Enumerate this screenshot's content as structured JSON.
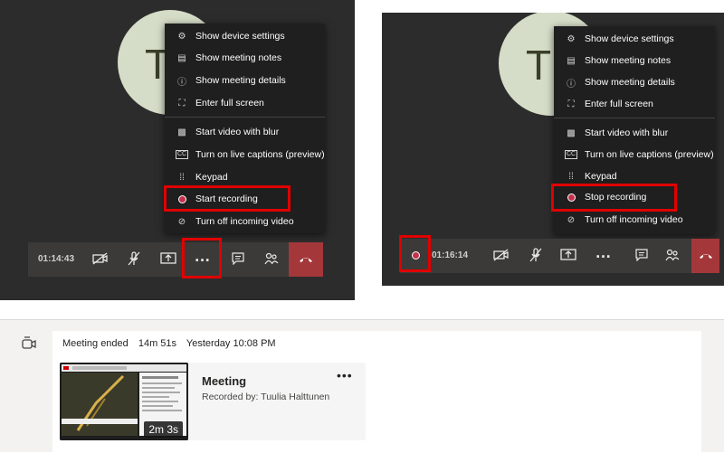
{
  "left_panel": {
    "avatar_letter": "T",
    "menu_items": [
      {
        "label": "Show device settings",
        "icon": "gear-icon"
      },
      {
        "label": "Show meeting notes",
        "icon": "notes-icon"
      },
      {
        "label": "Show meeting details",
        "icon": "info-icon"
      },
      {
        "label": "Enter full screen",
        "icon": "fullscreen-icon"
      },
      {
        "label": "Start video with blur",
        "icon": "blur-icon"
      },
      {
        "label": "Turn on live captions (preview)",
        "icon": "captions-icon"
      },
      {
        "label": "Keypad",
        "icon": "keypad-icon"
      },
      {
        "label": "Start recording",
        "icon": "record-icon"
      },
      {
        "label": "Turn off incoming video",
        "icon": "video-off-icon"
      }
    ],
    "timer": "01:14:43"
  },
  "right_panel": {
    "avatar_letter": "T",
    "menu_items": [
      {
        "label": "Show device settings",
        "icon": "gear-icon"
      },
      {
        "label": "Show meeting notes",
        "icon": "notes-icon"
      },
      {
        "label": "Show meeting details",
        "icon": "info-icon"
      },
      {
        "label": "Enter full screen",
        "icon": "fullscreen-icon"
      },
      {
        "label": "Start video with blur",
        "icon": "blur-icon"
      },
      {
        "label": "Turn on live captions (preview)",
        "icon": "captions-icon"
      },
      {
        "label": "Keypad",
        "icon": "keypad-icon"
      },
      {
        "label": "Stop recording",
        "icon": "record-icon"
      },
      {
        "label": "Turn off incoming video",
        "icon": "video-off-icon"
      }
    ],
    "timer": "01:16:14"
  },
  "meeting_summary": {
    "status": "Meeting ended",
    "duration": "14m 51s",
    "when": "Yesterday 10:08 PM",
    "recording": {
      "title": "Meeting",
      "recorded_by": "Recorded by: Tuulia Halttunen",
      "length": "2m 3s"
    }
  },
  "colors": {
    "panel_bg": "#2d2c2c",
    "menu_bg": "#1f1f1f",
    "toolbar_bg": "#3b3a39",
    "hangup": "#a4373a",
    "highlight": "#e00000",
    "record": "#c4314b",
    "avatar": "#d5dcc7"
  }
}
